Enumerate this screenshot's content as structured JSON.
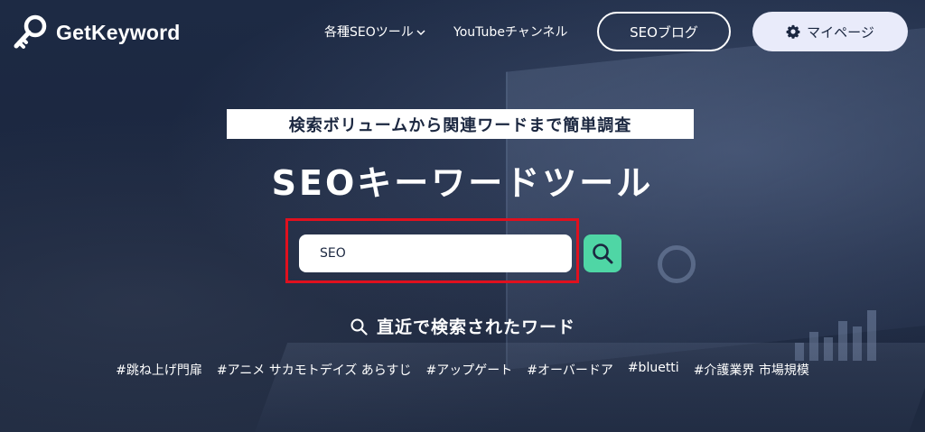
{
  "brand": {
    "name": "GetKeyword"
  },
  "nav": {
    "tools_label": "各種SEOツール",
    "youtube_label": "YouTubeチャンネル",
    "blog_label": "SEOブログ",
    "mypage_label": "マイページ"
  },
  "hero": {
    "tagline": "検索ボリュームから関連ワードまで簡単調査",
    "title": "SEOキーワードツール"
  },
  "search": {
    "value": "SEO"
  },
  "recent": {
    "title": "直近で検索されたワード",
    "tags": [
      "#跳ね上げ門扉",
      "#アニメ サカモトデイズ あらすじ",
      "#アップゲート",
      "#オーバードア",
      "#bluetti",
      "#介護業界 市場規模"
    ]
  },
  "colors": {
    "background": "#1b2740",
    "accent_green": "#4fd6a5",
    "highlight_red": "#e0101e",
    "mypage_bg": "#e9ebfa"
  },
  "icons": {
    "logo": "key-icon",
    "chevron": "chevron-down-icon",
    "gear": "gear-icon",
    "search": "search-icon"
  }
}
